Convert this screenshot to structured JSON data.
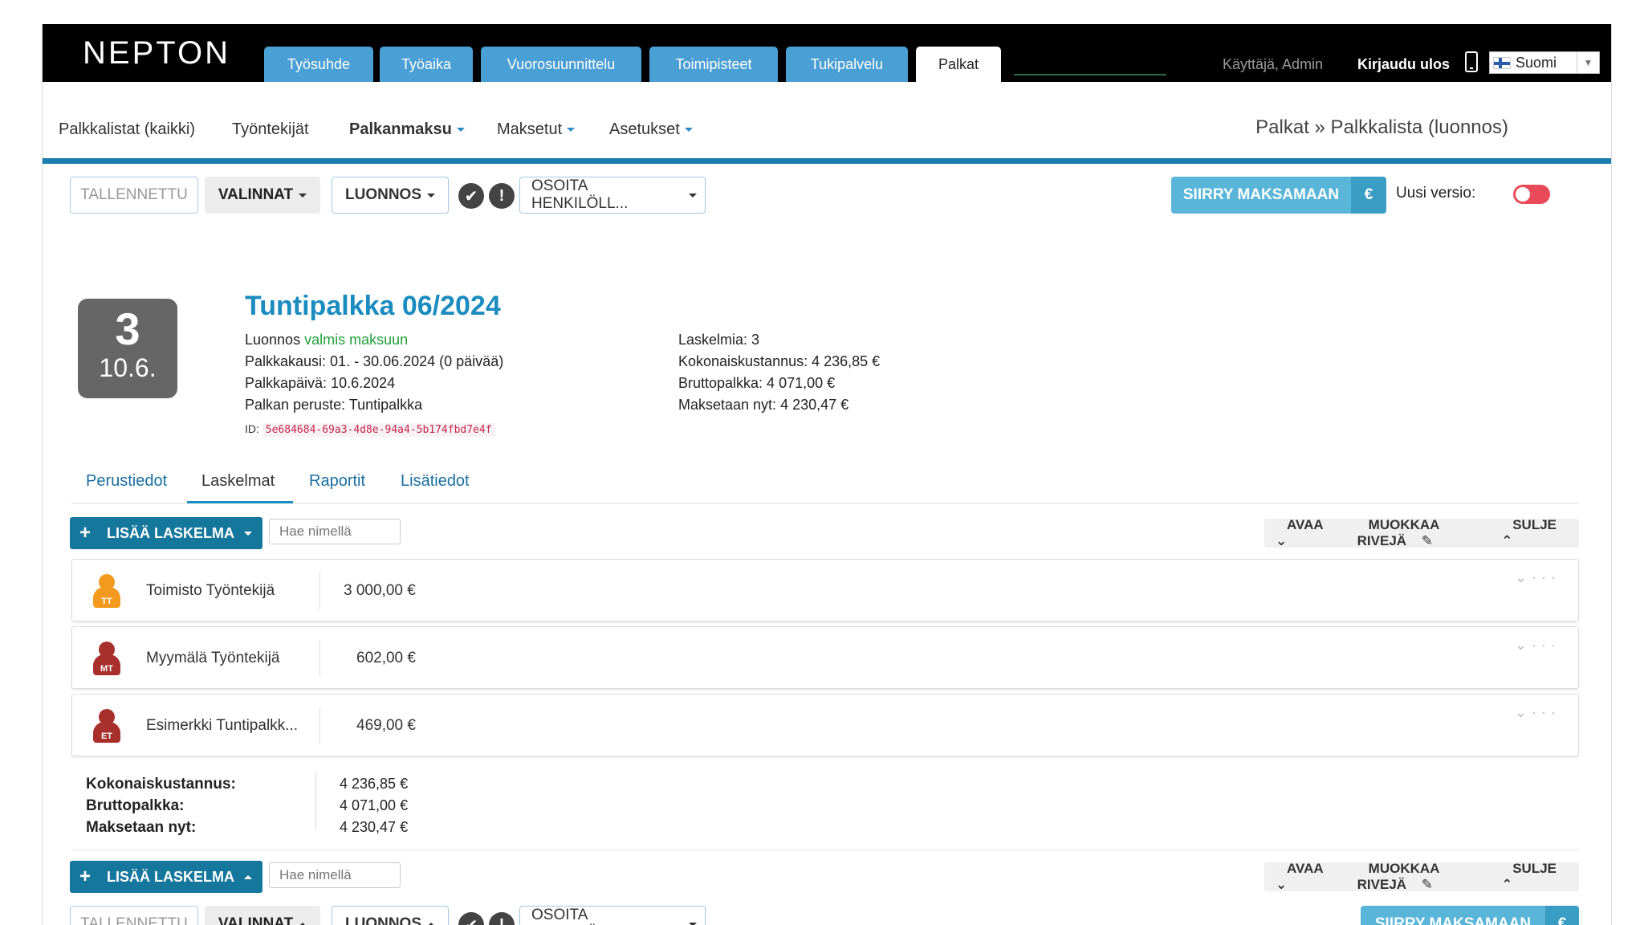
{
  "topbar": {
    "logo": "NEPTON",
    "tabs": [
      {
        "label": "Työsuhde"
      },
      {
        "label": "Työaika"
      },
      {
        "label": "Vuorosuunnittelu"
      },
      {
        "label": "Toimipisteet"
      },
      {
        "label": "Tukipalvelu"
      },
      {
        "label": "Palkat"
      }
    ],
    "user": "Käyttäjä, Admin",
    "logout": "Kirjaudu ulos",
    "language": "Suomi"
  },
  "subnav": {
    "items": [
      {
        "label": "Palkkalistat (kaikki)"
      },
      {
        "label": "Työntekijät"
      },
      {
        "label": "Palkanmaksu"
      },
      {
        "label": "Maksetut"
      },
      {
        "label": "Asetukset"
      }
    ],
    "breadcrumb": "Palkat » Palkkalista (luonnos)"
  },
  "toolbar": {
    "saved": "TALLENNETTU",
    "options": "VALINNAT",
    "draft": "LUONNOS",
    "assign": "OSOITA HENKILÖLL...",
    "pay": "SIIRRY MAKSAMAAN",
    "euro": "€",
    "new_version": "Uusi versio:",
    "check_icon": "✔",
    "alert_icon": "!"
  },
  "header": {
    "badge_count": "3",
    "badge_date": "10.6.",
    "title": "Tuntipalkka 06/2024",
    "status_prefix": "Luonnos",
    "status_value": "valmis maksuun",
    "period": "Palkkakausi: 01. - 30.06.2024 (0 päivää)",
    "payday": "Palkkapäivä: 10.6.2024",
    "basis": "Palkan peruste: Tuntipalkka",
    "id_label": "ID:",
    "id_value": "5e684684-69a3-4d8e-94a4-5b174fbd7e4f",
    "calc_count": "Laskelmia: 3",
    "total_cost": "Kokonaiskustannus: 4 236,85 €",
    "gross": "Bruttopalkka: 4 071,00 €",
    "pay_now": "Maksetaan nyt: 4 230,47 €"
  },
  "page_tabs": [
    {
      "label": "Perustiedot"
    },
    {
      "label": "Laskelmat"
    },
    {
      "label": "Raportit"
    },
    {
      "label": "Lisätiedot"
    }
  ],
  "actions": {
    "add_label": "LISÄÄ LASKELMA",
    "search_placeholder": "Hae nimellä",
    "open": "AVAA",
    "edit_rows": "MUOKKAA RIVEJÄ",
    "close": "SULJE"
  },
  "rows": [
    {
      "initials": "TT",
      "name": "Toimisto Työntekijä",
      "amount": "3 000,00 €",
      "color": "#f39a1e"
    },
    {
      "initials": "MT",
      "name": "Myymälä Työntekijä",
      "amount": "602,00 €",
      "color": "#a8302c"
    },
    {
      "initials": "ET",
      "name": "Esimerkki Tuntipalkk...",
      "amount": "469,00 €",
      "color": "#a8302c"
    }
  ],
  "totals": {
    "cost_label": "Kokonaiskustannus:",
    "cost_value": "4 236,85 €",
    "gross_label": "Bruttopalkka:",
    "gross_value": "4 071,00 €",
    "paynow_label": "Maksetaan nyt:",
    "paynow_value": "4 230,47 €"
  },
  "colors": {
    "accent": "#1a8cbf",
    "tab_blue": "#4a9fd5",
    "primary_button": "#5ab6d8",
    "add_button": "#15779c",
    "toggle_off": "#e84a5a",
    "status_green": "#21a03a"
  }
}
